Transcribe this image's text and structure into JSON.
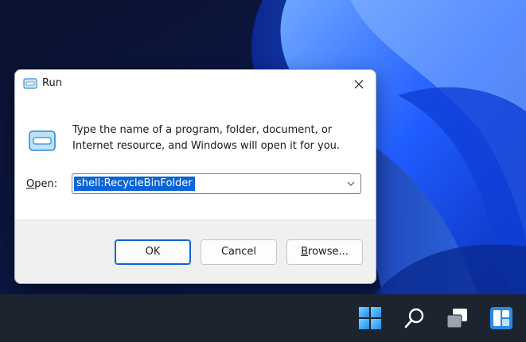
{
  "dialog": {
    "title": "Run",
    "title_icon": "run-icon",
    "close_icon": "close-icon",
    "big_icon": "run-program-icon",
    "description": "Type the name of a program, folder, document, or Internet resource, and Windows will open it for you.",
    "open_label_mnemonic": "O",
    "open_label_rest": "pen:",
    "open_value": "shell:RecycleBinFolder",
    "ok_label": "OK",
    "cancel_label": "Cancel",
    "browse_mnemonic": "B",
    "browse_rest": "rowse..."
  },
  "taskbar": {
    "icons": [
      "windows-start-icon",
      "search-icon",
      "task-view-icon",
      "widgets-icon"
    ]
  },
  "colors": {
    "accent": "#0a64d6",
    "wallpaper_dark": "#0a1430",
    "wallpaper_blue": "#1e5bff",
    "taskbar": "#1c2430"
  }
}
